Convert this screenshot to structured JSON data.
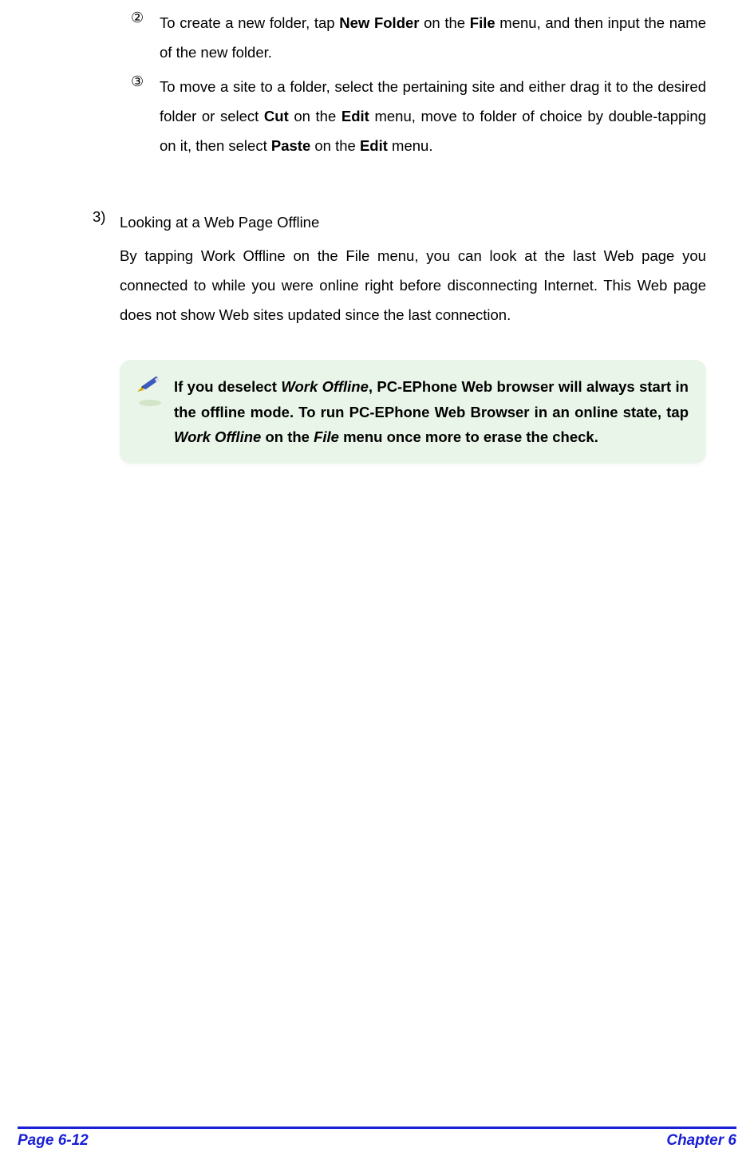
{
  "items": {
    "item2": {
      "marker": "②",
      "text_pre": "To create a new folder, tap ",
      "bold1": "New Folder",
      "text_mid": " on the ",
      "bold2": "File",
      "text_post": " menu, and then input the name of the new folder."
    },
    "item3": {
      "marker": "③",
      "text_a": "To move a site to a folder, select the pertaining site and either drag it to the desired folder or select ",
      "bold1": "Cut",
      "text_b": " on the ",
      "bold2": "Edit",
      "text_c": " menu, move to folder of choice by double-tapping on it, then select ",
      "bold3": "Paste",
      "text_d": " on the ",
      "bold4": "Edit",
      "text_e": " menu."
    }
  },
  "section3": {
    "marker": "3)",
    "title": "Looking at a Web Page Offline",
    "body_a": "By tapping ",
    "bold1": "Work Offline",
    "body_b": " on the ",
    "bold2": "File",
    "body_c": " menu, you can look at the last Web page you connected to while you were online right before disconnecting Internet. This Web page does not show Web sites updated since the last connection."
  },
  "note": {
    "t1": "If you deselect ",
    "i1": "Work Offline",
    "t2": ", PC-EPhone Web browser will always start in the offline mode. To run PC-EPhone Web Browser in an online state, tap ",
    "i2": "Work Offline",
    "t3": " on the ",
    "i3": "File",
    "t4": " menu once more to erase the check."
  },
  "footer": {
    "left": "Page 6-12",
    "right": "Chapter 6"
  }
}
